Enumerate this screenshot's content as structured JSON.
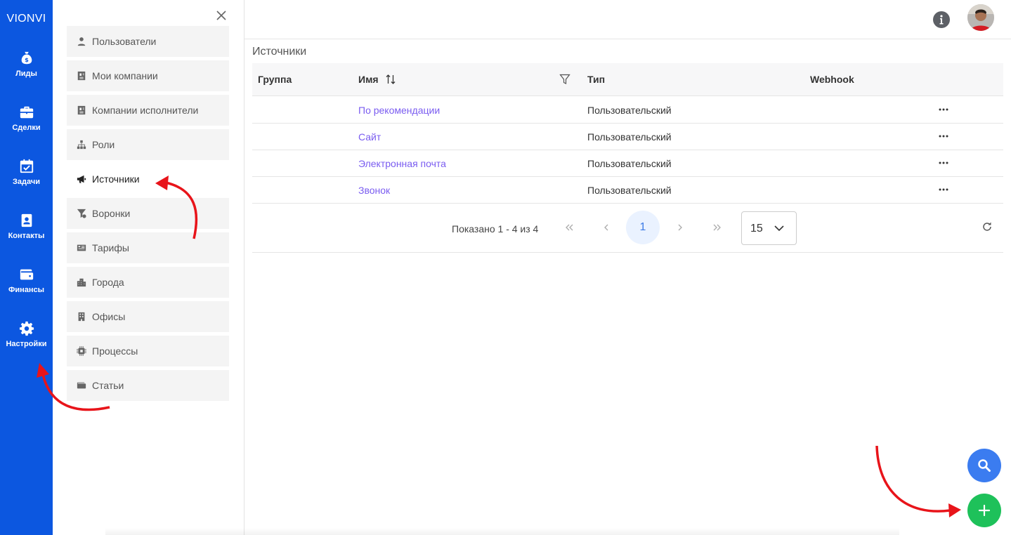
{
  "app": {
    "brand": "VIONVI"
  },
  "rail": {
    "items": [
      {
        "label": "Лиды",
        "icon": "money-bag-icon"
      },
      {
        "label": "Сделки",
        "icon": "briefcase-icon"
      },
      {
        "label": "Задачи",
        "icon": "calendar-check-icon"
      },
      {
        "label": "Контакты",
        "icon": "contact-book-icon"
      },
      {
        "label": "Финансы",
        "icon": "wallet-icon"
      },
      {
        "label": "Настройки",
        "icon": "gear-icon"
      }
    ]
  },
  "settings_menu": {
    "items": [
      {
        "label": "Пользователи",
        "icon": "user-icon"
      },
      {
        "label": "Мои компании",
        "icon": "id-card-icon"
      },
      {
        "label": "Компании исполнители",
        "icon": "id-card-icon"
      },
      {
        "label": "Роли",
        "icon": "hierarchy-icon"
      },
      {
        "label": "Источники",
        "icon": "megaphone-icon",
        "active": true
      },
      {
        "label": "Воронки",
        "icon": "funnel-icon"
      },
      {
        "label": "Тарифы",
        "icon": "price-list-icon"
      },
      {
        "label": "Города",
        "icon": "city-icon"
      },
      {
        "label": "Офисы",
        "icon": "building-icon"
      },
      {
        "label": "Процессы",
        "icon": "chip-icon"
      },
      {
        "label": "Статьи",
        "icon": "wallet-icon"
      }
    ]
  },
  "main": {
    "title": "Источники",
    "table": {
      "columns": [
        "Группа",
        "Имя",
        "Тип",
        "Webhook"
      ],
      "rows": [
        {
          "group": "",
          "name": "По рекомендации",
          "type": "Пользовательский",
          "webhook": ""
        },
        {
          "group": "",
          "name": "Сайт",
          "type": "Пользовательский",
          "webhook": ""
        },
        {
          "group": "",
          "name": "Электронная почта",
          "type": "Пользовательский",
          "webhook": ""
        },
        {
          "group": "",
          "name": "Звонок",
          "type": "Пользовательский",
          "webhook": ""
        }
      ]
    },
    "pagination": {
      "summary": "Показано 1 - 4 из 4",
      "current_page": "1",
      "page_size": "15"
    }
  },
  "colors": {
    "rail": "#0c57e0",
    "link": "#7a5cf0",
    "search_fab": "#3b7cf0",
    "add_fab": "#1ec15a",
    "annotation_arrow": "#e8141a"
  }
}
